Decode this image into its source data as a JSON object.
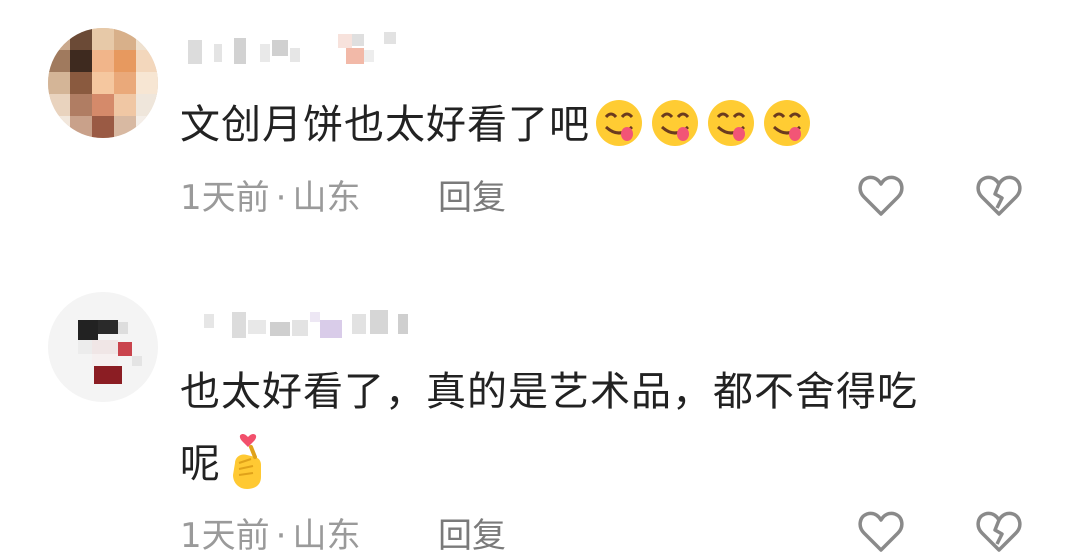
{
  "comments": [
    {
      "text": "文创月饼也太好看了吧",
      "emojis": [
        "yum-face",
        "yum-face",
        "yum-face",
        "yum-face"
      ],
      "time": "1天前",
      "separator": "·",
      "location": "山东",
      "reply_label": "回复"
    },
    {
      "text_line1": "也太好看了，真的是艺术品，都不舍得吃",
      "text_line2": "呢",
      "emoji": "finger-heart",
      "time": "1天前",
      "separator": "·",
      "location": "山东",
      "reply_label": "回复"
    }
  ],
  "colors": {
    "text": "#222222",
    "meta": "#9a9a9a",
    "icon": "#8a8a8a",
    "emoji_face": "#ffcc33"
  }
}
